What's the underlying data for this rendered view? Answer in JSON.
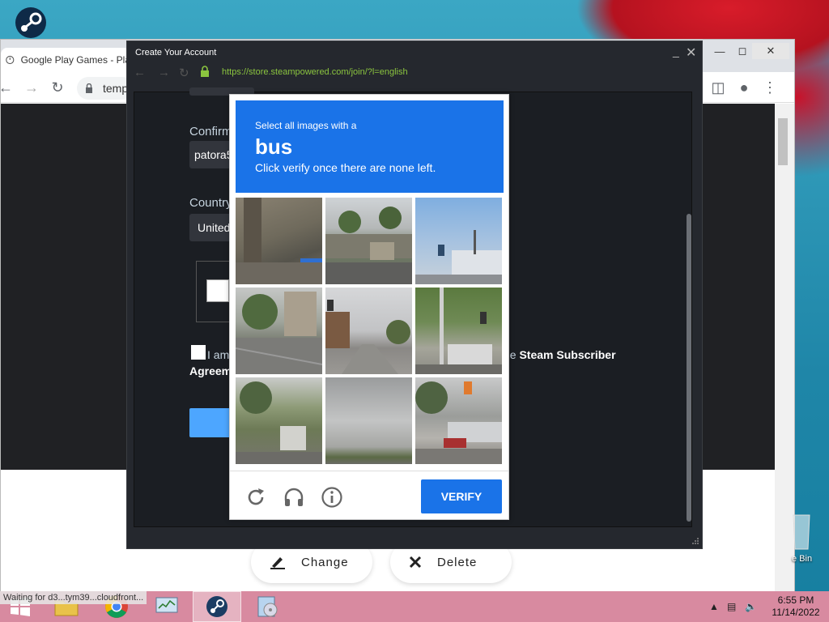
{
  "chrome": {
    "tab_title": "Google Play Games - Pla",
    "address_partial": "temp"
  },
  "steam_dialog": {
    "title": "Create Your Account",
    "url": "https://store.steampowered.com/join/?l=english",
    "confirm_label": "Confirm",
    "confirm_value": "patora5",
    "country_label": "Country",
    "country_value": "United",
    "agree_left": "I am",
    "agree_right_prefix": "he ",
    "agree_link": "Steam Subscriber",
    "agree_line2": "Agreem"
  },
  "captcha": {
    "instruction_line1": "Select all images with a",
    "target": "bus",
    "instruction_line3": "Click verify once there are none left.",
    "verify_label": "VERIFY",
    "footer_icons": [
      "refresh-icon",
      "headphones-icon",
      "info-icon"
    ],
    "accent_color": "#1a73e8"
  },
  "page_buttons": {
    "change_label": "Change",
    "delete_label": "Delete"
  },
  "desktop": {
    "recycle_bin_label": "e Bin"
  },
  "taskbar": {
    "status_text": "Waiting for d3...tym39...cloudfront...",
    "time": "6:55 PM",
    "date": "11/14/2022"
  }
}
